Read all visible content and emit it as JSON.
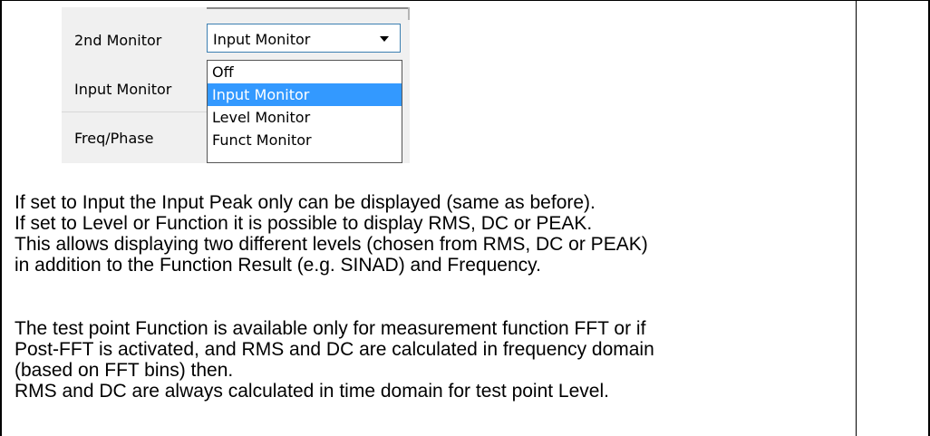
{
  "dialog": {
    "rows": {
      "second_monitor_label": "2nd Monitor",
      "input_monitor_label": "Input Monitor",
      "freq_phase_label": "Freq/Phase"
    },
    "combo": {
      "value": "Input Monitor",
      "arrow_icon": "chevron-down-icon"
    },
    "dropdown": {
      "options": [
        "Off",
        "Input Monitor",
        "Level Monitor",
        "Funct Monitor"
      ],
      "selected": "Input Monitor",
      "highlight_color": "#3399ff"
    }
  },
  "text": {
    "paragraph1": [
      "If set to Input the Input Peak only can be displayed (same as before).",
      "If set to Level or Function it is possible to display RMS, DC or PEAK.",
      "This allows displaying two different levels (chosen from RMS, DC or PEAK)",
      "in addition to the Function Result (e.g. SINAD) and Frequency."
    ],
    "paragraph2": [
      "The test point Function is available only for measurement function FFT or if",
      "Post-FFT is activated, and RMS and DC are calculated in frequency domain",
      "(based on FFT bins) then.",
      "RMS and DC are always calculated in time domain for test point Level."
    ]
  }
}
